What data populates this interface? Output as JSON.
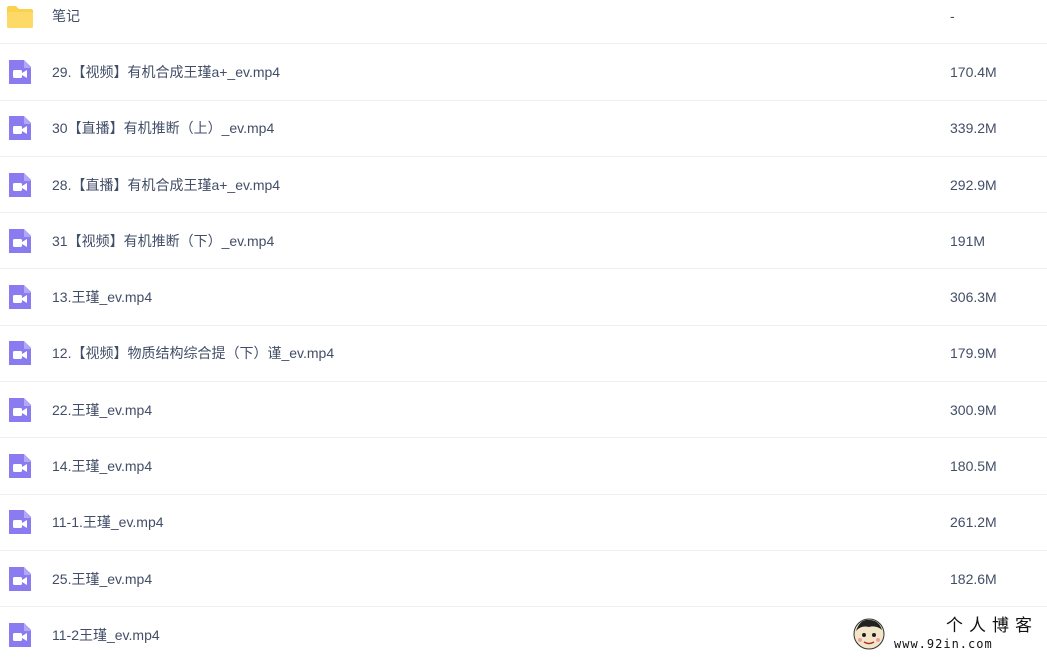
{
  "files": [
    {
      "name": "笔记",
      "size": "-",
      "type": "folder",
      "icon": "folder-icon"
    },
    {
      "name": "29.【视频】有机合成王瑾a+_ev.mp4",
      "size": "170.4M",
      "type": "video",
      "icon": "video-file-icon"
    },
    {
      "name": "30【直播】有机推断（上）_ev.mp4",
      "size": "339.2M",
      "type": "video",
      "icon": "video-file-icon"
    },
    {
      "name": "28.【直播】有机合成王瑾a+_ev.mp4",
      "size": "292.9M",
      "type": "video",
      "icon": "video-file-icon"
    },
    {
      "name": "31【视频】有机推断（下）_ev.mp4",
      "size": "191M",
      "type": "video",
      "icon": "video-file-icon"
    },
    {
      "name": "13.王瑾_ev.mp4",
      "size": "306.3M",
      "type": "video",
      "icon": "video-file-icon"
    },
    {
      "name": "12.【视频】物质结构综合提（下）谨_ev.mp4",
      "size": "179.9M",
      "type": "video",
      "icon": "video-file-icon"
    },
    {
      "name": "22.王瑾_ev.mp4",
      "size": "300.9M",
      "type": "video",
      "icon": "video-file-icon"
    },
    {
      "name": "14.王瑾_ev.mp4",
      "size": "180.5M",
      "type": "video",
      "icon": "video-file-icon"
    },
    {
      "name": "11-1.王瑾_ev.mp4",
      "size": "261.2M",
      "type": "video",
      "icon": "video-file-icon"
    },
    {
      "name": "25.王瑾_ev.mp4",
      "size": "182.6M",
      "type": "video",
      "icon": "video-file-icon"
    },
    {
      "name": "11-2王瑾_ev.mp4",
      "size": "",
      "type": "video",
      "icon": "video-file-icon"
    }
  ],
  "colors": {
    "folder": "#fcd24c",
    "video": "#8a7cf0",
    "text": "#424e67",
    "divider": "#f0f0f2"
  },
  "watermark": {
    "title": "个人博客",
    "url": "www.92in.com"
  }
}
